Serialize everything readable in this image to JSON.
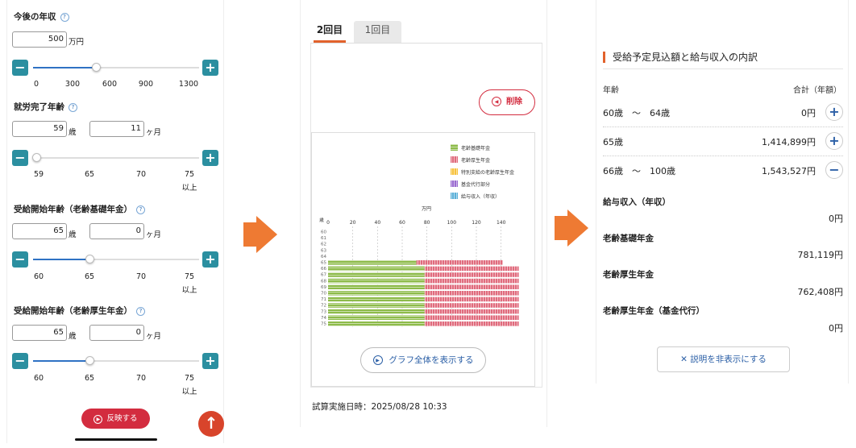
{
  "left": {
    "income": {
      "title": "今後の年収",
      "help": "?",
      "value": "500",
      "unit": "万円",
      "minus": "−",
      "plus": "+",
      "ticks": [
        "0",
        "300",
        "600",
        "900",
        "1300"
      ],
      "slider_fraction": 0.38
    },
    "retire": {
      "title": "就労完了年齢",
      "help": "?",
      "years": "59",
      "years_unit": "歳",
      "months": "11",
      "months_unit": "ヶ月",
      "minus": "−",
      "plus": "+",
      "ticks": [
        "59",
        "65",
        "70",
        "75"
      ],
      "tick_last_sub": "以上",
      "slider_fraction": 0.02
    },
    "basic_pension": {
      "title": "受給開始年齢（老齢基礎年金）",
      "help": "?",
      "years": "65",
      "years_unit": "歳",
      "months": "0",
      "months_unit": "ヶ月",
      "minus": "−",
      "plus": "+",
      "ticks": [
        "60",
        "65",
        "70",
        "75"
      ],
      "tick_last_sub": "以上",
      "slider_fraction": 0.34
    },
    "employee_pension": {
      "title": "受給開始年齢（老齢厚生年金）",
      "help": "?",
      "years": "65",
      "years_unit": "歳",
      "months": "0",
      "months_unit": "ヶ月",
      "minus": "−",
      "plus": "+",
      "ticks": [
        "60",
        "65",
        "70",
        "75"
      ],
      "tick_last_sub": "以上",
      "slider_fraction": 0.34
    },
    "apply_label": "反映する",
    "apply_icon": "▶",
    "scroll_top_icon": "↑"
  },
  "middle": {
    "tabs": [
      {
        "label": "2回目",
        "active": true
      },
      {
        "label": "1回目",
        "active": false
      }
    ],
    "delete_label": "削除",
    "delete_icon": "◀",
    "full_graph_label": "グラフ全体を表示する",
    "full_graph_icon": "▶",
    "exec_time": "試算実施日時：2025/08/28 10:33"
  },
  "right": {
    "title": "受給予定見込額と給与収入の内訳",
    "head_age": "年齢",
    "head_total": "合計（年額）",
    "rows": [
      {
        "age": "60歳　～　64歳",
        "amount": "0円",
        "button": "+"
      },
      {
        "age": "65歳",
        "amount": "1,414,899円",
        "button": "+"
      },
      {
        "age": "66歳　～　100歳",
        "amount": "1,543,527円",
        "button": "−"
      }
    ],
    "details": [
      {
        "label": "給与収入（年収）",
        "value": "0円"
      },
      {
        "label": "老齢基礎年金",
        "value": "781,119円"
      },
      {
        "label": "老齢厚生年金",
        "value": "762,408円"
      },
      {
        "label": "老齢厚生年金（基金代行）",
        "value": "0円"
      }
    ],
    "toggle_label": "✕ 説明を非表示にする"
  },
  "chart_data": {
    "type": "bar",
    "orientation": "horizontal",
    "stacked": true,
    "unit_label": "万円",
    "age_axis_label": "歳",
    "x_ticks": [
      "0",
      "20",
      "40",
      "60",
      "80",
      "100",
      "120",
      "140"
    ],
    "xlim": [
      0,
      150
    ],
    "categories": [
      "60",
      "61",
      "62",
      "63",
      "64",
      "65",
      "66",
      "67",
      "68",
      "69",
      "70",
      "71",
      "72",
      "73",
      "74",
      "75"
    ],
    "legend": [
      "老齢基礎年金",
      "老齢厚生年金",
      "特別支給の老齢厚生年金",
      "基金代行部分",
      "給与収入（年収）"
    ],
    "legend_placement": "top-right",
    "series": [
      {
        "name": "老齢基礎年金",
        "color": "#8dbb4a",
        "values": [
          0,
          0,
          0,
          0,
          0,
          71.5,
          78.1,
          78.1,
          78.1,
          78.1,
          78.1,
          78.1,
          78.1,
          78.1,
          78.1,
          78.1
        ]
      },
      {
        "name": "老齢厚生年金",
        "color": "#e06b7d",
        "values": [
          0,
          0,
          0,
          0,
          0,
          70.0,
          76.2,
          76.2,
          76.2,
          76.2,
          76.2,
          76.2,
          76.2,
          76.2,
          76.2,
          76.2
        ]
      },
      {
        "name": "特別支給の老齢厚生年金",
        "color": "#f7c23c",
        "values": [
          0,
          0,
          0,
          0,
          0,
          0,
          0,
          0,
          0,
          0,
          0,
          0,
          0,
          0,
          0,
          0
        ]
      },
      {
        "name": "基金代行部分",
        "color": "#9a6bd0",
        "values": [
          0,
          0,
          0,
          0,
          0,
          0,
          0,
          0,
          0,
          0,
          0,
          0,
          0,
          0,
          0,
          0
        ]
      },
      {
        "name": "給与収入（年収）",
        "color": "#5bb0d8",
        "values": [
          0,
          0,
          0,
          0,
          0,
          0,
          0,
          0,
          0,
          0,
          0,
          0,
          0,
          0,
          0,
          0
        ]
      }
    ]
  }
}
